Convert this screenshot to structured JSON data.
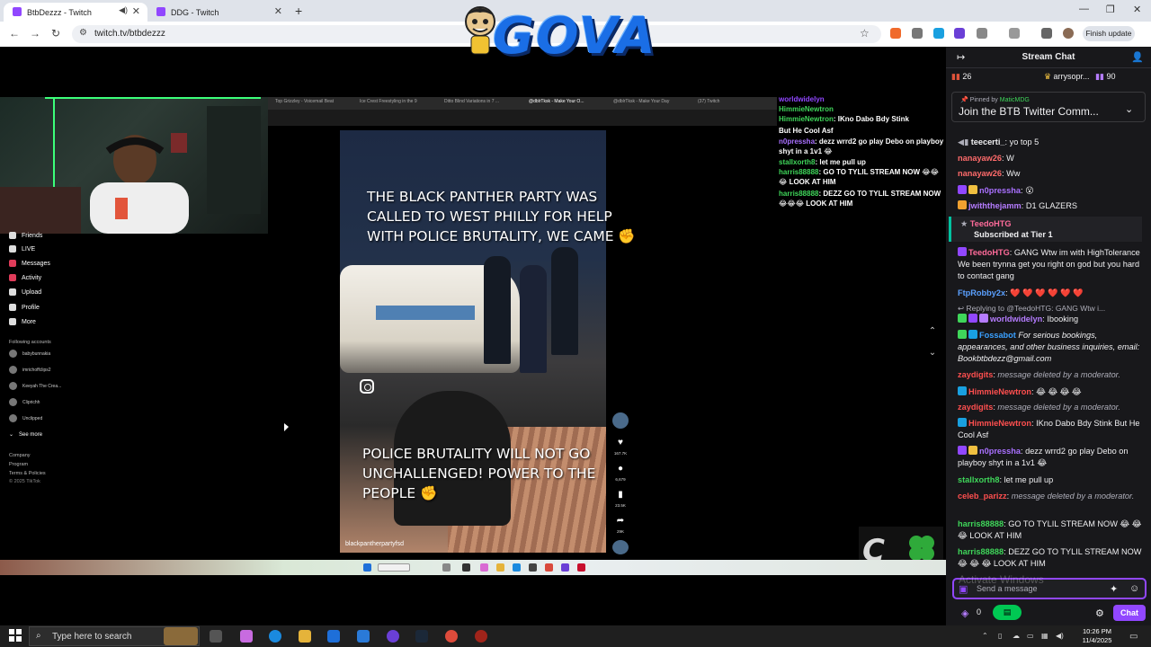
{
  "browser": {
    "tabs": [
      {
        "label": "BtbDezzz - Twitch",
        "active": true
      },
      {
        "label": "DDG - Twitch",
        "active": false
      }
    ],
    "url": "twitch.tv/btbdezzz",
    "finish_update": "Finish update"
  },
  "overlay_logo": "GOVA",
  "inner_browser_tabs": [
    "Top Grizzley - Voicemail Beat",
    "Ice Crest Freestyling in the 9",
    "Ditto Blind Variations in 7 ...",
    "@dblrTksk - Make Your O...",
    "@dblrTksk - Make Your Day",
    "(37) Twitch"
  ],
  "tiktok": {
    "nav": [
      "Friends",
      "LIVE",
      "Messages",
      "Activity",
      "Upload",
      "Profile",
      "More"
    ],
    "following_header": "Following accounts",
    "accounts": [
      [
        "babybunnakia",
        "babybunnakia"
      ],
      [
        "imrichoffclips2",
        "imrichoffclips2"
      ],
      [
        "Keeyah The Crea...",
        "_keeyah.xo"
      ],
      [
        "Cliprichh",
        "richaarcyys"
      ],
      [
        "Unclipped",
        "unclipped"
      ]
    ],
    "see_more": "See more",
    "footer": [
      "Company",
      "Program",
      "Terms & Policies",
      "© 2025 TikTok"
    ]
  },
  "video": {
    "caption_top": "THE BLACK PANTHER PARTY WAS CALLED TO WEST PHILLY FOR HELP WITH POLICE BRUTALITY, WE CAME ✊",
    "caption_top_lines": [
      "THE BLACK PANTHER PARTY WAS",
      "CALLED TO WEST PHILLY FOR HELP",
      "WITH POLICE BRUTALITY, WE CAME ✊"
    ],
    "caption_bottom_lines": [
      "POLICE BRUTALITY WILL NOT GO",
      "UNCHALLENGED! POWER TO THE",
      "PEOPLE ✊"
    ],
    "handle": "blackpantherpartyfsd",
    "rail_counts": [
      "167.7K",
      "6,679",
      "23.5K",
      "29K"
    ]
  },
  "overlay_chat": [
    {
      "user": "worldwidelyn",
      "text": "",
      "color": "#9147ff"
    },
    {
      "user": "HimmieNewtron",
      "text": "",
      "color": "#3fd65a"
    },
    {
      "user": "HimmieNewtron",
      "text": "IKno Dabo Bdy Stink",
      "color": "#3fd65a"
    },
    {
      "user": "",
      "text": "But He Cool Asf",
      "color": "#fff"
    },
    {
      "user": "n0pressha",
      "text": "dezz wrrd2 go play Debo on playboy shyt in a 1v1 😂",
      "color": "#9147ff"
    },
    {
      "user": "stallxorth8",
      "text": "let me pull up",
      "color": "#3fd65a"
    },
    {
      "user": "harris88888",
      "text": "GO TO TYLIL STREAM NOW 😂😂😂 LOOK AT HIM",
      "color": "#3fd65a"
    },
    {
      "user": "harris88888",
      "text": "DEZZ GO TO TYLIL STREAM NOW😂😂😂 LOOK AT HIM",
      "color": "#3fd65a"
    }
  ],
  "chat": {
    "title": "Stream Chat",
    "leaderboard": [
      {
        "rank": "26",
        "user": ""
      },
      {
        "rank": "",
        "user": "arrysopr..."
      },
      {
        "rank": "90",
        "user": ""
      }
    ],
    "pinned_by": "Pinned by",
    "pinned_user": "MaticMDG",
    "pinned_text": "Join the BTB Twitter Comm...",
    "messages": [
      {
        "user": "teecerti_",
        "text": "yo top 5",
        "color": "#efeff1"
      },
      {
        "user": "nanayaw26",
        "text": "W",
        "color": "#ff6b6b"
      },
      {
        "user": "nanayaw26",
        "text": "Ww",
        "color": "#ff6b6b"
      },
      {
        "user": "n0pressha",
        "text": "😮",
        "color": "#a970ff"
      },
      {
        "user": "jwiththejamm",
        "text": "D1 GLAZERS",
        "color": "#b57cff"
      },
      {
        "user": "TeedoHTG",
        "text": "GANG Wtw im with HighTolerance We been trynna get you right on god but you hard to contact gang",
        "color": "#ff6b9a"
      },
      {
        "user": "FtpRobby2x",
        "text": "❤️ ❤️ ❤️ ❤️ ❤️ ❤️",
        "color": "#5aa0ff"
      },
      {
        "user": "worldwidelyn",
        "text": "Ibooking",
        "color": "#b57cff"
      },
      {
        "user": "Fossabot",
        "text": "For serious bookings, appearances, and other business inquiries, email: Bookbtbdezz@gmail.com",
        "color": "#3aa0ff"
      },
      {
        "user": "zaydigits",
        "text": "message deleted by a moderator.",
        "color": "#ff4f4f"
      },
      {
        "user": "HimmieNewtron",
        "text": "😂 😂 😂 😂",
        "color": "#ff4f4f"
      },
      {
        "user": "zaydigits",
        "text": "message deleted by a moderator.",
        "color": "#ff4f4f"
      },
      {
        "user": "HimmieNewtron",
        "text": "IKno Dabo Bdy Stink But He Cool Asf",
        "color": "#ff4f4f"
      },
      {
        "user": "n0pressha",
        "text": "dezz wrrd2 go play Debo on playboy shyt in a 1v1 😂",
        "color": "#a970ff"
      },
      {
        "user": "stallxorth8",
        "text": "let me pull up",
        "color": "#3fd65a"
      },
      {
        "user": "celeb_parizz",
        "text": "message deleted by a moderator.",
        "color": "#ff4f4f"
      },
      {
        "user": "harris88888",
        "text": "GO TO TYLIL STREAM NOW 😂 😂 😂 LOOK AT HIM",
        "color": "#3fd65a"
      },
      {
        "user": "harris88888",
        "text": "DEZZ GO TO TYLIL STREAM NOW 😂 😂 😂 LOOK AT HIM",
        "color": "#3fd65a"
      }
    ],
    "sub_user": "TeedoHTG",
    "sub_text": "Subscribed at Tier 1",
    "reply_to": "Replying to @TeedoHTG: GANG Wtw i...",
    "input_placeholder": "Send a message",
    "points": "0",
    "chat_button": "Chat",
    "watermark": "Activate Windows",
    "watermark_sub": "Go to Settings to activate Windows."
  },
  "taskbar": {
    "search_placeholder": "Type here to search",
    "time": "10:26 PM",
    "date": "11/4/2025"
  }
}
